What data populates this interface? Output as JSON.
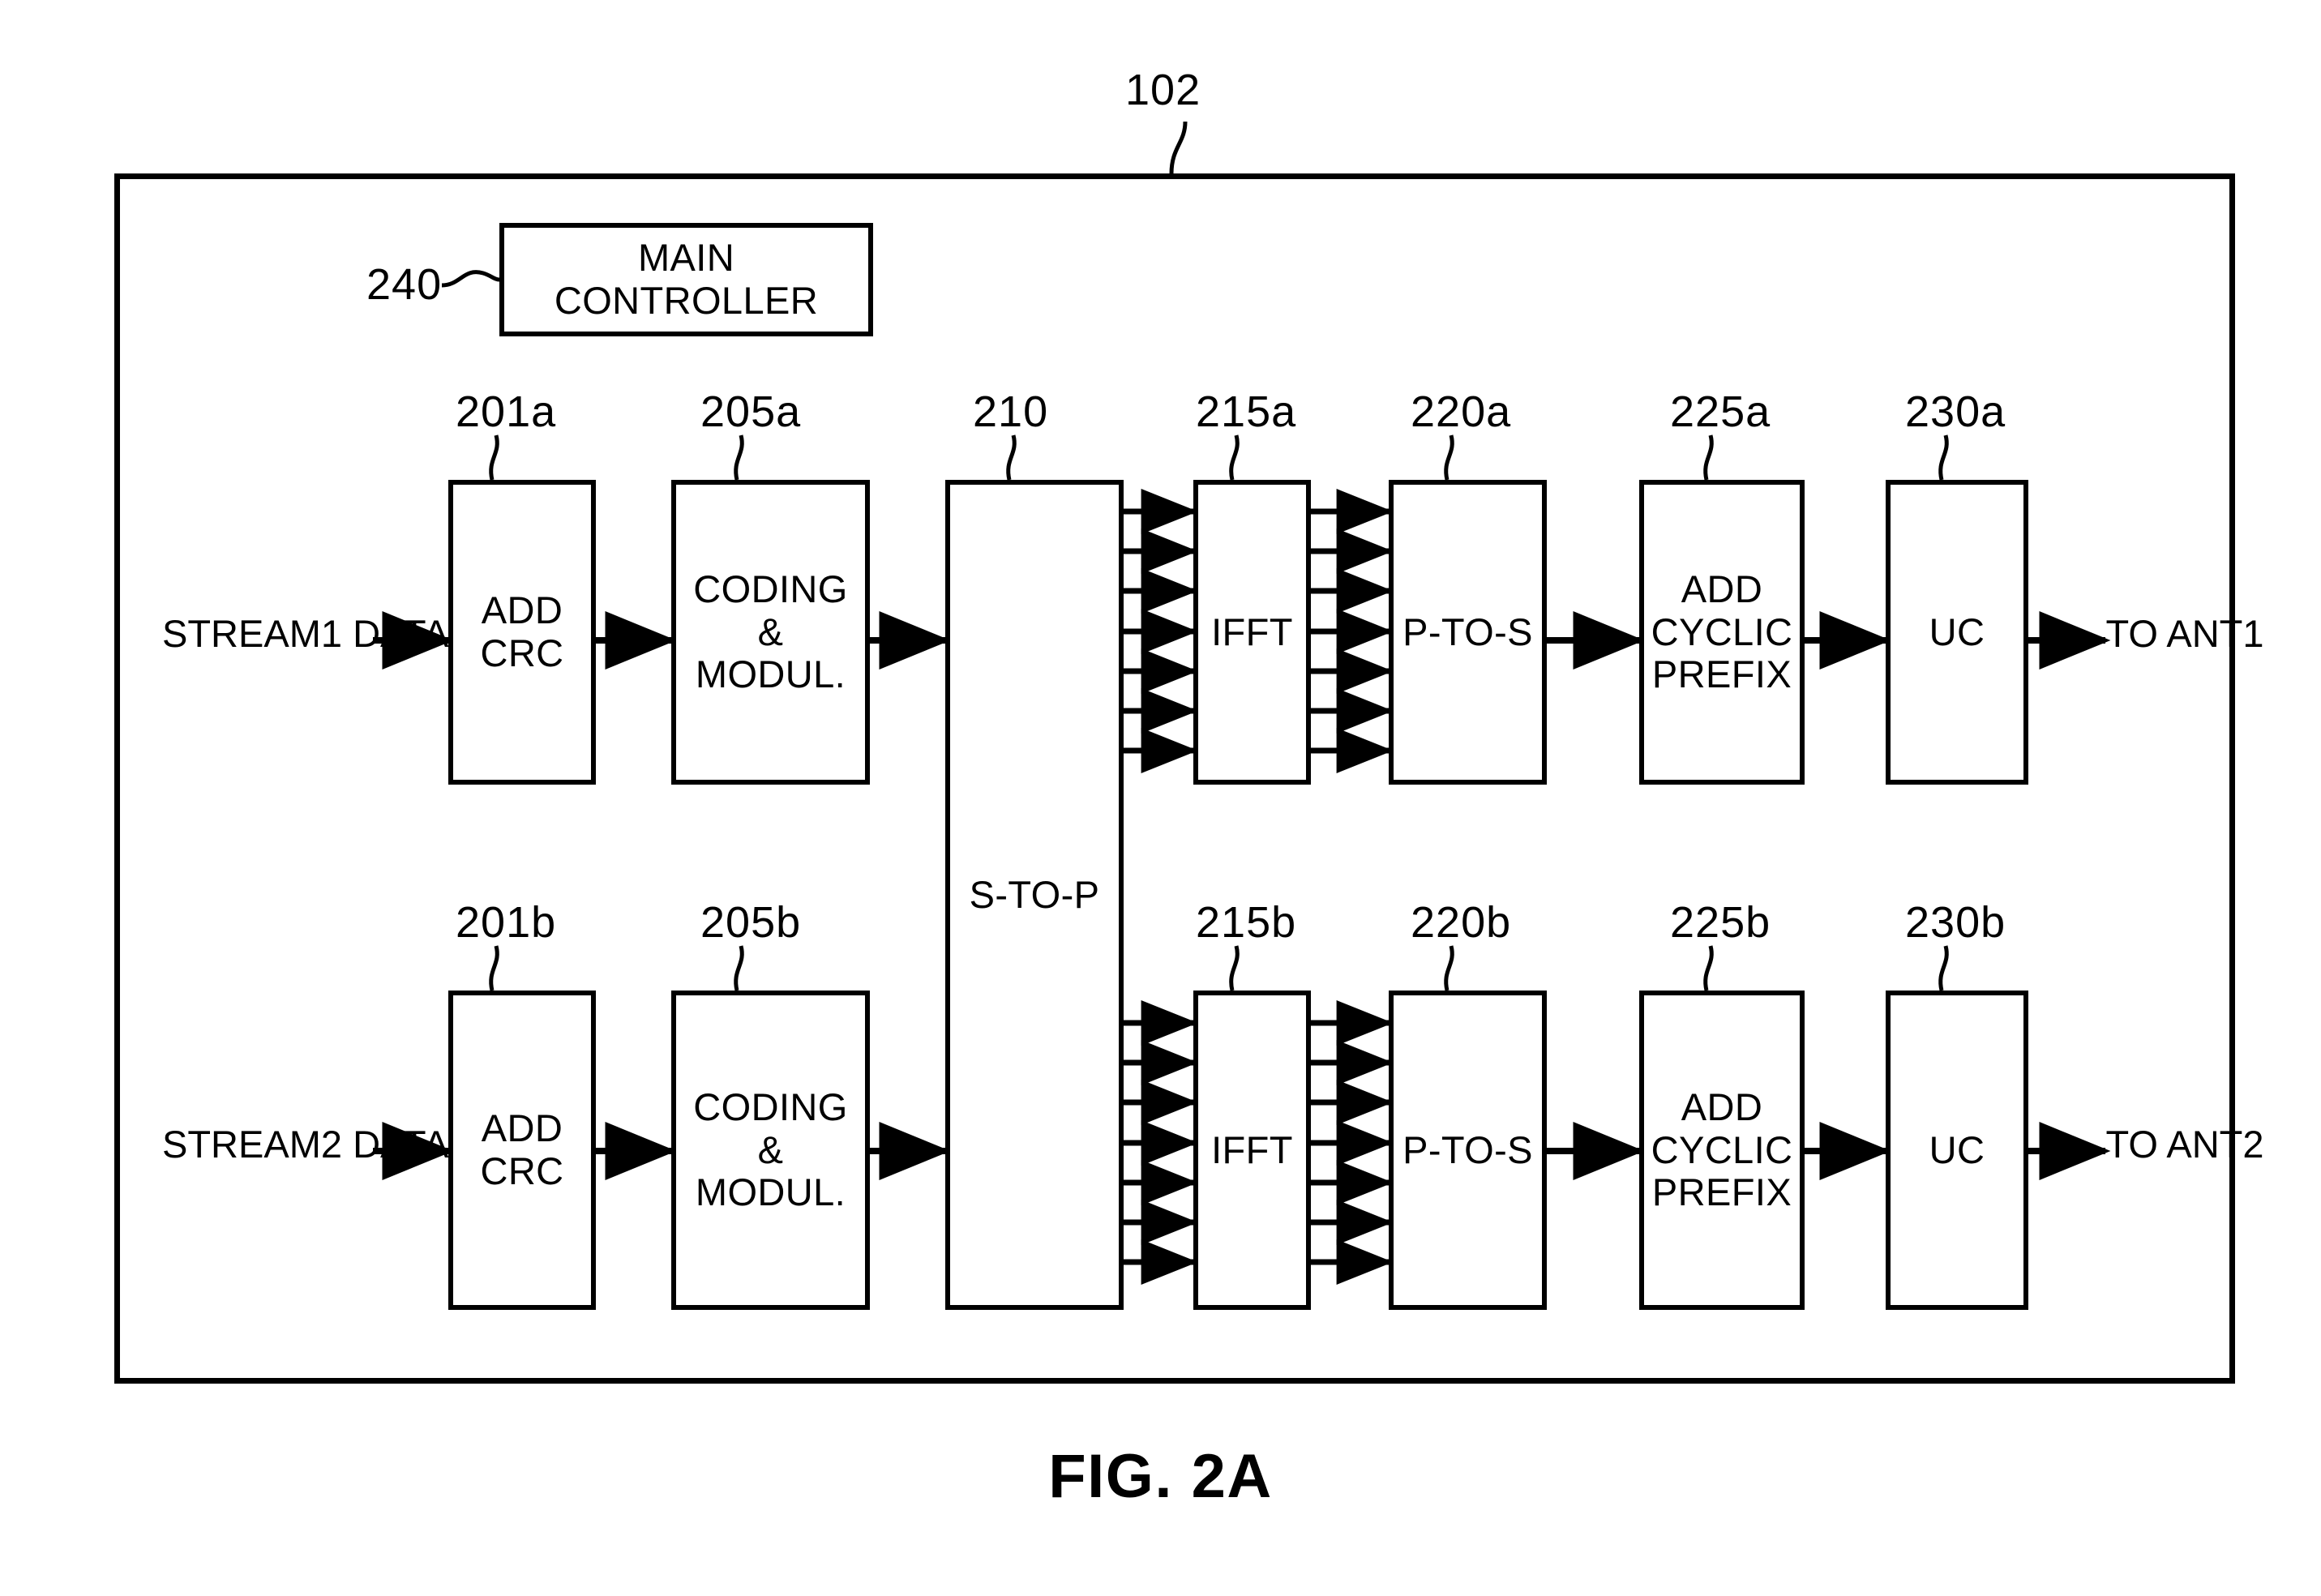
{
  "figure": {
    "caption": "FIG. 2A",
    "system_ref": "102"
  },
  "controller": {
    "label": "MAIN CONTROLLER",
    "ref": "240"
  },
  "common": {
    "s_to_p": {
      "label": "S-TO-P",
      "ref": "210"
    }
  },
  "chains": [
    {
      "id": "a",
      "input_label_line1": "STREAM1",
      "input_label_line2": "DATA",
      "output_label_line1": "TO",
      "output_label_line2": "ANT1",
      "blocks": [
        {
          "ref": "201a",
          "line1": "ADD",
          "line2": "CRC",
          "line3": ""
        },
        {
          "ref": "205a",
          "line1": "CODING",
          "line2": "&",
          "line3": "MODUL."
        },
        {
          "ref": "215a",
          "line1": "IFFT",
          "line2": "",
          "line3": ""
        },
        {
          "ref": "220a",
          "line1": "P-TO-S",
          "line2": "",
          "line3": ""
        },
        {
          "ref": "225a",
          "line1": "ADD",
          "line2": "CYCLIC",
          "line3": "PREFIX"
        },
        {
          "ref": "230a",
          "line1": "UC",
          "line2": "",
          "line3": ""
        }
      ],
      "parallel_bus_lines": 7
    },
    {
      "id": "b",
      "input_label_line1": "STREAM2",
      "input_label_line2": "DATA",
      "output_label_line1": "TO",
      "output_label_line2": "ANT2",
      "blocks": [
        {
          "ref": "201b",
          "line1": "ADD",
          "line2": "CRC",
          "line3": ""
        },
        {
          "ref": "205b",
          "line1": "CODING",
          "line2": "&",
          "line3": "MODUL."
        },
        {
          "ref": "215b",
          "line1": "IFFT",
          "line2": "",
          "line3": ""
        },
        {
          "ref": "220b",
          "line1": "P-TO-S",
          "line2": "",
          "line3": ""
        },
        {
          "ref": "225b",
          "line1": "ADD",
          "line2": "CYCLIC",
          "line3": "PREFIX"
        },
        {
          "ref": "230b",
          "line1": "UC",
          "line2": "",
          "line3": ""
        }
      ],
      "parallel_bus_lines": 7
    }
  ],
  "colors": {
    "ink": "#000000",
    "paper": "#ffffff"
  }
}
